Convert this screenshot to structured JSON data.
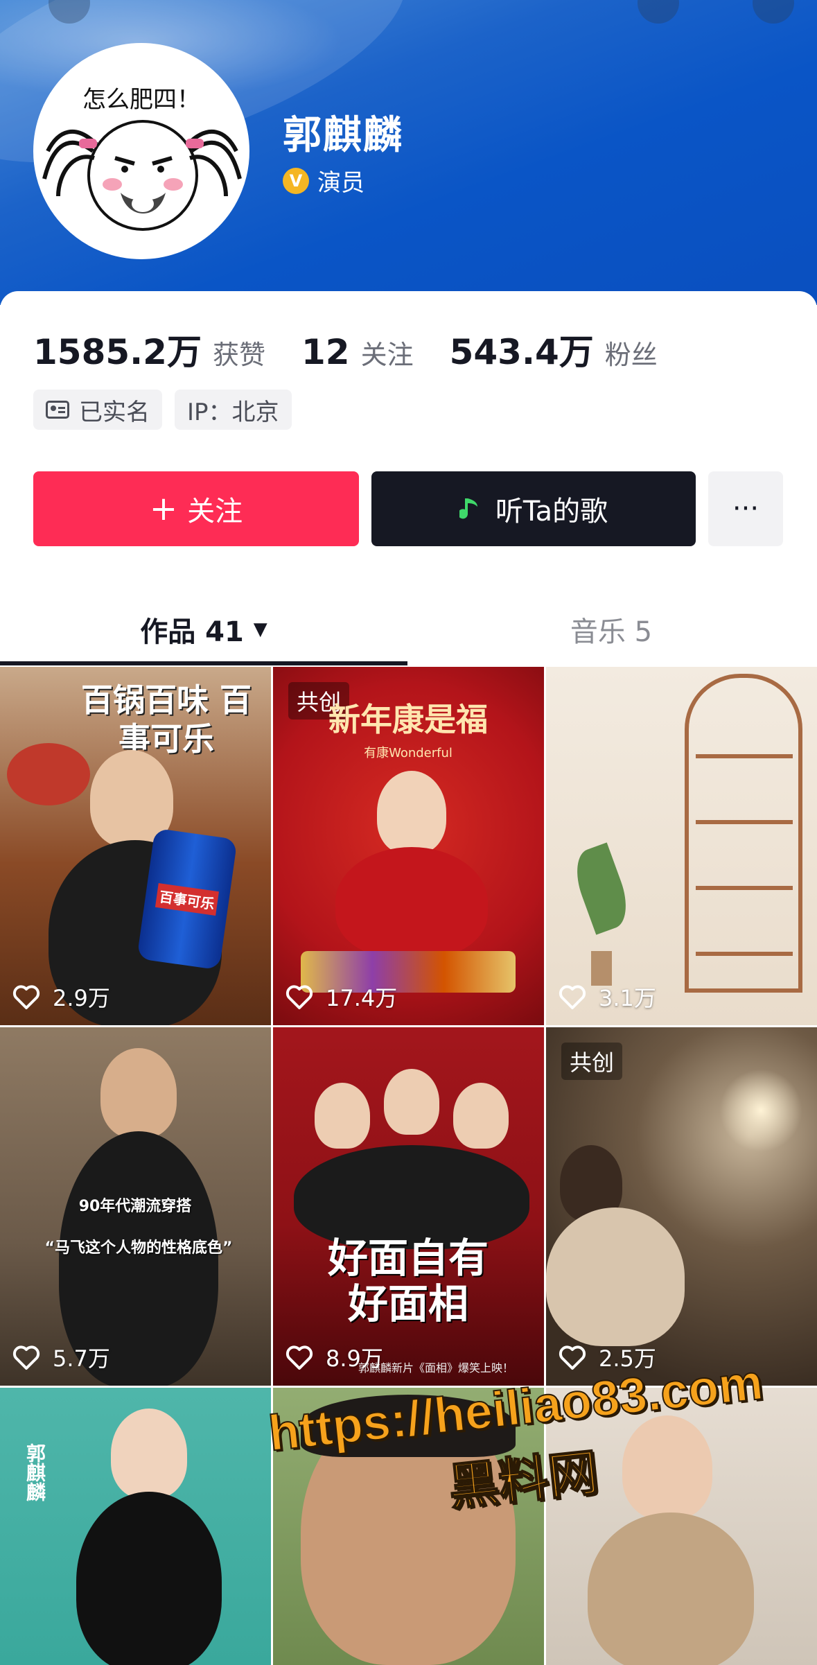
{
  "profile": {
    "avatar_caption": "怎么肥四！",
    "name": "郭麒麟",
    "verified_role": "演员"
  },
  "stats": [
    {
      "value": "1585.2万",
      "label": "获赞"
    },
    {
      "value": "12",
      "label": "关注"
    },
    {
      "value": "543.4万",
      "label": "粉丝"
    }
  ],
  "tags": {
    "realname": "已实名",
    "ip": "IP：北京"
  },
  "actions": {
    "follow": "关注",
    "follow_plus": "+",
    "listen": "听Ta的歌",
    "more": "···"
  },
  "tabs": {
    "works": "作品 41",
    "music": "音乐 5"
  },
  "posts": [
    {
      "likes": "2.9万",
      "title": "百锅百味 百事可乐",
      "product": "百事可乐",
      "bg": "#8a4a26"
    },
    {
      "likes": "17.4万",
      "cocreate": "共创",
      "title": "新年康是福",
      "subtitle": "有康Wonderful",
      "bg": "#b3141a"
    },
    {
      "likes": "3.1万",
      "bg": "#efe4d6"
    },
    {
      "likes": "5.7万",
      "caption_a": "90年代潮流穿搭",
      "caption_b": "“马飞这个人物的性格底色”",
      "bg": "#6b5a49"
    },
    {
      "likes": "8.9万",
      "title": "好面自有 好面相",
      "footer": "郭麒麟新片《面相》爆笑上映！",
      "bg": "#8e1116"
    },
    {
      "likes": "2.5万",
      "cocreate": "共创",
      "bg": "#4a3a2c"
    },
    {
      "bg": "#3aa89c",
      "side": "郭麒麟"
    },
    {
      "bg": "#6f8a4f"
    },
    {
      "bg": "#cfc5b8"
    }
  ],
  "watermark": {
    "url": "https://heiliao83.com",
    "site": "黑料网"
  }
}
